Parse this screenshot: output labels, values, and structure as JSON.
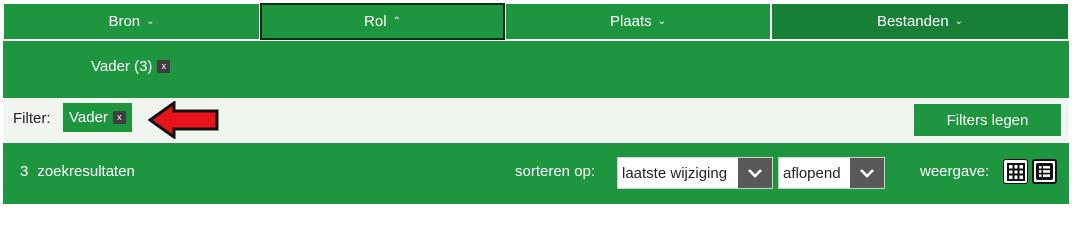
{
  "tabs": [
    {
      "label": "Bron",
      "chevron": "⌄"
    },
    {
      "label": "Rol",
      "chevron": "⌃"
    },
    {
      "label": "Plaats",
      "chevron": "⌄"
    },
    {
      "label": "Bestanden",
      "chevron": "⌄"
    }
  ],
  "panel": {
    "chip_label": "Vader (3)",
    "remove_symbol": "x"
  },
  "filter": {
    "label": "Filter:",
    "active_chip": "Vader",
    "remove_symbol": "x",
    "clear_label": "Filters legen"
  },
  "results": {
    "count": "3",
    "count_label": "zoekresultaten",
    "sort_label": "sorteren op:",
    "sort_value": "laatste wijziging",
    "order_value": "aflopend",
    "view_label": "weergave:"
  },
  "icons": {
    "annotation_arrow": "red-arrow-icon",
    "grid_view": "grid-view-icon",
    "list_view": "list-view-icon",
    "caret": "chevron-down-icon"
  },
  "colors": {
    "brand_green": "#1e9640",
    "arrow_red": "#e8141b",
    "filter_bg": "#f0f5f0"
  }
}
